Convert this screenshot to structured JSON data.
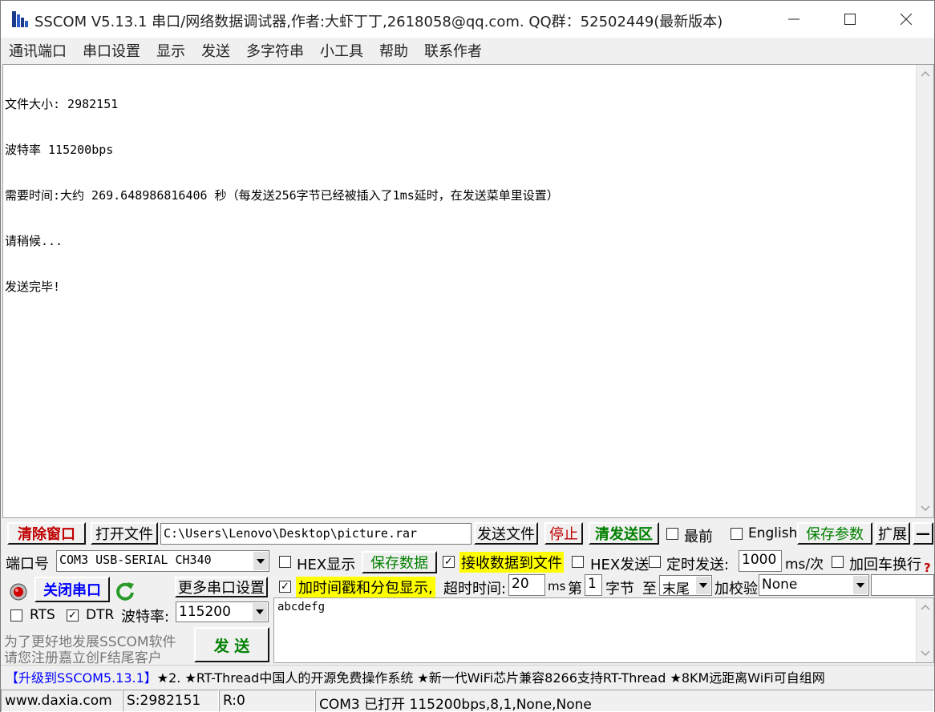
{
  "window": {
    "title": "SSCOM V5.13.1 串口/网络数据调试器,作者:大虾丁丁,2618058@qq.com. QQ群：52502449(最新版本)"
  },
  "menu": [
    "通讯端口",
    "串口设置",
    "显示",
    "发送",
    "多字符串",
    "小工具",
    "帮助",
    "联系作者"
  ],
  "receive": {
    "lines": [
      "文件大小: 2982151",
      "波特率 115200bps",
      "需要时间:大约 269.648986816406 秒（每发送256字节已经被插入了1ms延时，在发送菜单里设置）",
      "请稍候...",
      "发送完毕!"
    ]
  },
  "file_bar": {
    "clear_window": "清除窗口",
    "open_file": "打开文件",
    "file_path": "C:\\Users\\Lenovo\\Desktop\\picture.rar",
    "send_file": "发送文件",
    "stop": "停止",
    "clear_send": "清发送区",
    "topmost": "最前",
    "english": "English",
    "save_params": "保存参数",
    "expand": "扩展",
    "collapse": "—"
  },
  "port": {
    "port_label": "端口号",
    "port_value": "COM3 USB-SERIAL CH340",
    "close_port": "关闭串口",
    "more_settings": "更多串口设置",
    "rts": "RTS",
    "dtr": "DTR",
    "baud_label": "波特率:",
    "baud_value": "115200",
    "promo_line1": "为了更好地发展SSCOM软件",
    "promo_line2": "请您注册嘉立创F结尾客户",
    "send_button": "发  送"
  },
  "options": {
    "hex_display": "HEX显示",
    "save_data": "保存数据",
    "recv_to_file": "接收数据到文件",
    "hex_send": "HEX发送",
    "timed_send": "定时发送:",
    "interval": "1000",
    "interval_unit": "ms/次",
    "add_crlf": "加回车换行",
    "timestamp": "加时间戳和分包显示,",
    "timeout_label": "超时时间:",
    "timeout_value": "20",
    "timeout_unit": "ms",
    "nth_label": "第",
    "nth_value": "1",
    "byte_label": "字节",
    "to_label": "至",
    "end_value": "末尾",
    "checksum_label": "加校验",
    "checksum_value": "None",
    "help_mark": "?"
  },
  "send_text": "abcdefg",
  "ad_bar": "【升级到SSCOM5.13.1】★2. ★RT-Thread中国人的开源免费操作系统 ★新一代WiFi芯片兼容8266支持RT-Thread ★8KM远距离WiFi可自组网",
  "ad_highlight": "【升级到SSCOM5.13.1】",
  "ad_rest": "★2. ★RT-Thread中国人的开源免费操作系统 ★新一代WiFi芯片兼容8266支持RT-Thread ★8KM远距离WiFi可自组网",
  "status": {
    "site": "www.daxia.com",
    "sent": "S:2982151",
    "received": "R:0",
    "info": "COM3 已打开  115200bps,8,1,None,None"
  },
  "colors": {
    "accent_red": "#c00000",
    "accent_green": "#008000",
    "highlight_yellow": "#ffff00",
    "link_blue": "#0000ff"
  }
}
